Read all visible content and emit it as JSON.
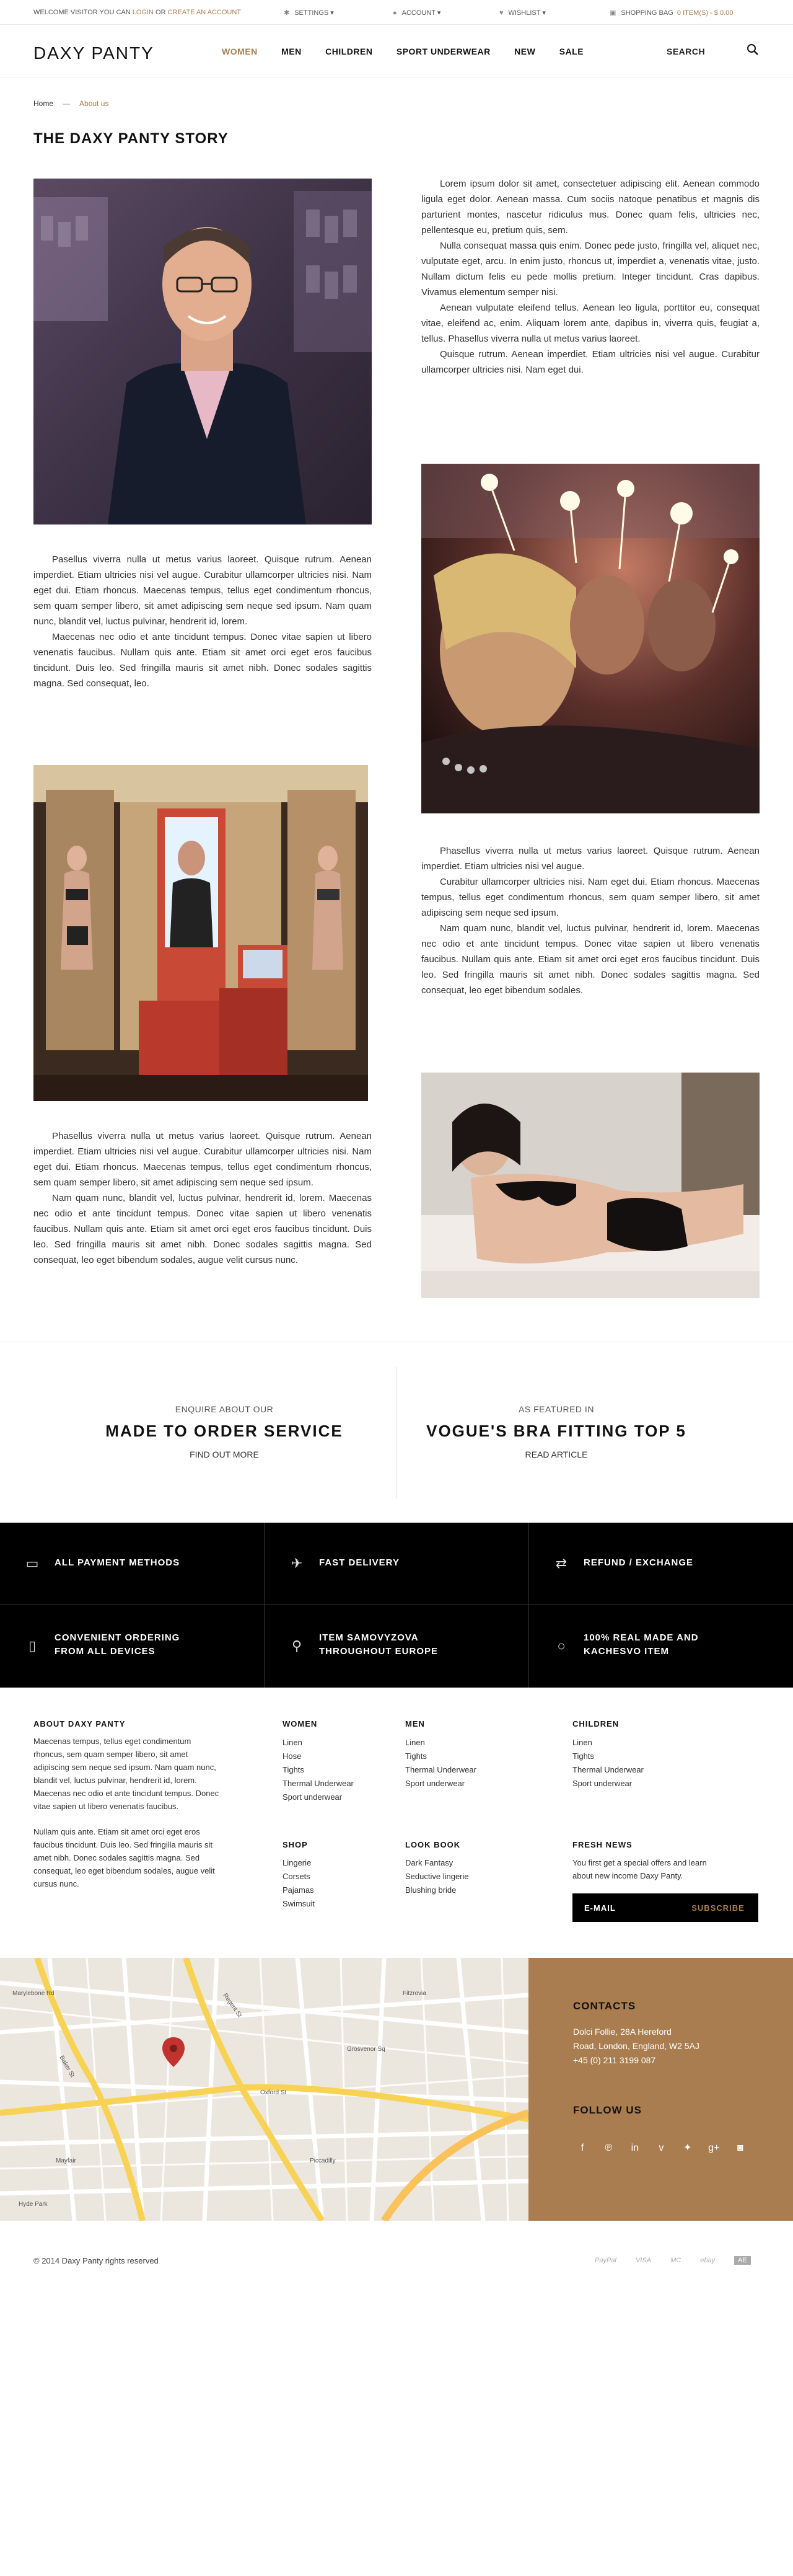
{
  "topbar": {
    "welcome_prefix": "WELCOME VISITOR YOU CAN",
    "login": "LOGIN",
    "or": "OR",
    "create": "CREATE AN ACCOUNT",
    "settings": "SETTINGS",
    "account": "ACCOUNT",
    "wishlist": "WISHLIST",
    "bag": "SHOPPING BAG",
    "bag_items": "0 ITEM(S) - $ 0.00"
  },
  "header": {
    "logo": "DAXY PANTY",
    "nav": [
      "WOMEN",
      "MEN",
      "CHILDREN",
      "SPORT UNDERWEAR",
      "NEW",
      "SALE"
    ],
    "search": "SEARCH"
  },
  "breadcrumb": {
    "home": "Home",
    "sep": "—",
    "current": "About us"
  },
  "page_title": "THE DAXY PANTY STORY",
  "content": {
    "block1": [
      "Lorem ipsum dolor sit amet, consectetuer adipiscing elit. Aenean commodo ligula eget dolor. Aenean massa. Cum sociis natoque penatibus et magnis dis parturient montes, nascetur ridiculus mus. Donec quam felis, ultricies nec, pellentesque eu, pretium quis, sem.",
      "Nulla consequat massa quis enim. Donec pede justo, fringilla vel, aliquet nec, vulputate eget, arcu. In enim justo, rhoncus ut, imperdiet a, venenatis vitae, justo. Nullam dictum felis eu pede mollis pretium. Integer tincidunt. Cras dapibus. Vivamus elementum semper nisi.",
      "Aenean vulputate eleifend tellus. Aenean leo ligula, porttitor eu, consequat vitae, eleifend ac, enim. Aliquam lorem ante, dapibus in, viverra quis, feugiat a, tellus. Phasellus viverra nulla ut metus varius laoreet.",
      "Quisque rutrum. Aenean imperdiet. Etiam ultricies nisi vel augue. Curabitur ullamcorper ultricies nisi. Nam eget dui."
    ],
    "block2": [
      "Pasellus viverra nulla ut metus varius laoreet. Quisque rutrum. Aenean imperdiet. Etiam ultricies nisi vel augue. Curabitur ullamcorper ultricies nisi. Nam eget dui. Etiam rhoncus. Maecenas tempus, tellus eget condimentum rhoncus, sem quam semper libero, sit amet adipiscing sem neque sed ipsum. Nam quam nunc, blandit vel, luctus pulvinar, hendrerit id, lorem.",
      "Maecenas nec odio et ante tincidunt tempus. Donec vitae sapien ut libero venenatis faucibus. Nullam quis ante. Etiam sit amet orci eget eros faucibus tincidunt. Duis leo. Sed fringilla mauris sit amet nibh. Donec sodales sagittis magna. Sed consequat, leo."
    ],
    "block3": [
      "Phasellus viverra nulla ut metus varius laoreet. Quisque rutrum. Aenean imperdiet. Etiam ultricies nisi vel augue.",
      "Curabitur ullamcorper ultricies nisi. Nam eget dui. Etiam rhoncus. Maecenas tempus, tellus eget condimentum rhoncus, sem quam semper libero, sit amet adipiscing sem neque sed ipsum.",
      "Nam quam nunc, blandit vel, luctus pulvinar, hendrerit id, lorem. Maecenas nec odio et ante tincidunt tempus. Donec vitae sapien ut libero venenatis faucibus. Nullam quis ante. Etiam sit amet orci eget eros faucibus tincidunt. Duis leo. Sed fringilla mauris sit amet nibh. Donec sodales sagittis magna. Sed consequat, leo eget bibendum sodales."
    ],
    "block4": [
      "Phasellus viverra nulla ut metus varius laoreet. Quisque rutrum. Aenean imperdiet. Etiam ultricies nisi vel augue. Curabitur ullamcorper ultricies nisi. Nam eget dui. Etiam rhoncus. Maecenas tempus, tellus eget condimentum rhoncus, sem quam semper libero, sit amet adipiscing sem neque sed ipsum.",
      "Nam quam nunc, blandit vel, luctus pulvinar, hendrerit id, lorem. Maecenas nec odio et ante tincidunt tempus. Donec vitae sapien ut libero venenatis faucibus. Nullam quis ante. Etiam sit amet orci eget eros faucibus tincidunt. Duis leo. Sed fringilla mauris sit amet nibh. Donec sodales sagittis magna. Sed consequat, leo eget bibendum sodales, augue velit cursus nunc."
    ]
  },
  "promo": {
    "left_small": "ENQUIRE ABOUT OUR",
    "left_big": "MADE TO ORDER SERVICE",
    "left_link": "FIND OUT MORE",
    "right_small": "AS FEATURED IN",
    "right_big": "VOGUE'S BRA FITTING TOP 5",
    "right_link": "READ ARTICLE"
  },
  "features": [
    {
      "icon": "credit-card-icon",
      "label": "ALL PAYMENT METHODS"
    },
    {
      "icon": "airplane-icon",
      "label": "FAST DELIVERY"
    },
    {
      "icon": "exchange-icon",
      "label": "REFUND / EXCHANGE"
    },
    {
      "icon": "mobile-icon",
      "label1": "CONVENIENT ORDERING",
      "label2": "FROM ALL DEVICES"
    },
    {
      "icon": "location-pin-icon",
      "label1": "ITEM SAMOVYZOVA",
      "label2": "THROUGHOUT EUROPE"
    },
    {
      "icon": "circle-icon",
      "label1": "100% REAL MADE AND",
      "label2": "KACHESVO ITEM"
    }
  ],
  "footer": {
    "about_title": "ABOUT DAXY PANTY",
    "about_p1": "Maecenas tempus, tellus eget condimentum rhoncus, sem quam semper libero, sit amet adipiscing sem neque sed ipsum. Nam quam nunc, blandit vel, luctus pulvinar, hendrerit id, lorem. Maecenas nec odio et ante tincidunt tempus. Donec vitae sapien ut libero venenatis faucibus.",
    "about_p2": "Nullam quis ante. Etiam sit amet orci eget eros faucibus tincidunt. Duis leo. Sed fringilla mauris sit amet nibh. Donec sodales sagittis magna. Sed consequat, leo eget bibendum sodales, augue velit cursus nunc.",
    "women_title": "WOMEN",
    "women": [
      "Linen",
      "Hose",
      "Tights",
      "Thermal Underwear",
      "Sport underwear"
    ],
    "men_title": "MEN",
    "men": [
      "Linen",
      "Tights",
      "Thermal Underwear",
      "Sport underwear"
    ],
    "children_title": "CHILDREN",
    "children": [
      "Linen",
      "Tights",
      "Thermal Underwear",
      "Sport underwear"
    ],
    "shop_title": "SHOP",
    "shop": [
      "Lingerie",
      "Corsets",
      "Pajamas",
      "Swimsuit"
    ],
    "lookbook_title": "LOOK BOOK",
    "lookbook": [
      "Dark Fantasy",
      "Seductive lingerie",
      "Blushing bride"
    ],
    "news_title": "FRESH NEWS",
    "news_text": "You first get a special offers and learn about new income Daxy Panty.",
    "email_placeholder": "E-MAIL",
    "subscribe": "SUBSCRIBE"
  },
  "contacts": {
    "title": "CONTACTS",
    "addr1": "Dolci Follie, 28A Hereford",
    "addr2": "Road, London, England, W2 5AJ",
    "phone": "+45 (0) 211 3199 087",
    "follow": "FOLLOW US",
    "social": [
      "facebook-icon",
      "pinterest-icon",
      "linkedin-icon",
      "vimeo-icon",
      "twitter-icon",
      "google-plus-icon",
      "instagram-icon"
    ]
  },
  "map": {
    "labels": [
      "Marylebone Rd",
      "Baker St",
      "Oxford St",
      "Regent St",
      "Mayfair",
      "Piccadilly",
      "Hyde Park",
      "Grosvenor Sq",
      "Fitzrovia"
    ]
  },
  "bottom": {
    "copyright": "© 2014 Daxy Panty rights reserved",
    "payments": [
      "PayPal",
      "VISA",
      "MC",
      "ebay",
      "AE"
    ]
  },
  "colors": {
    "accent": "#a97d4f",
    "dark": "#000000"
  }
}
